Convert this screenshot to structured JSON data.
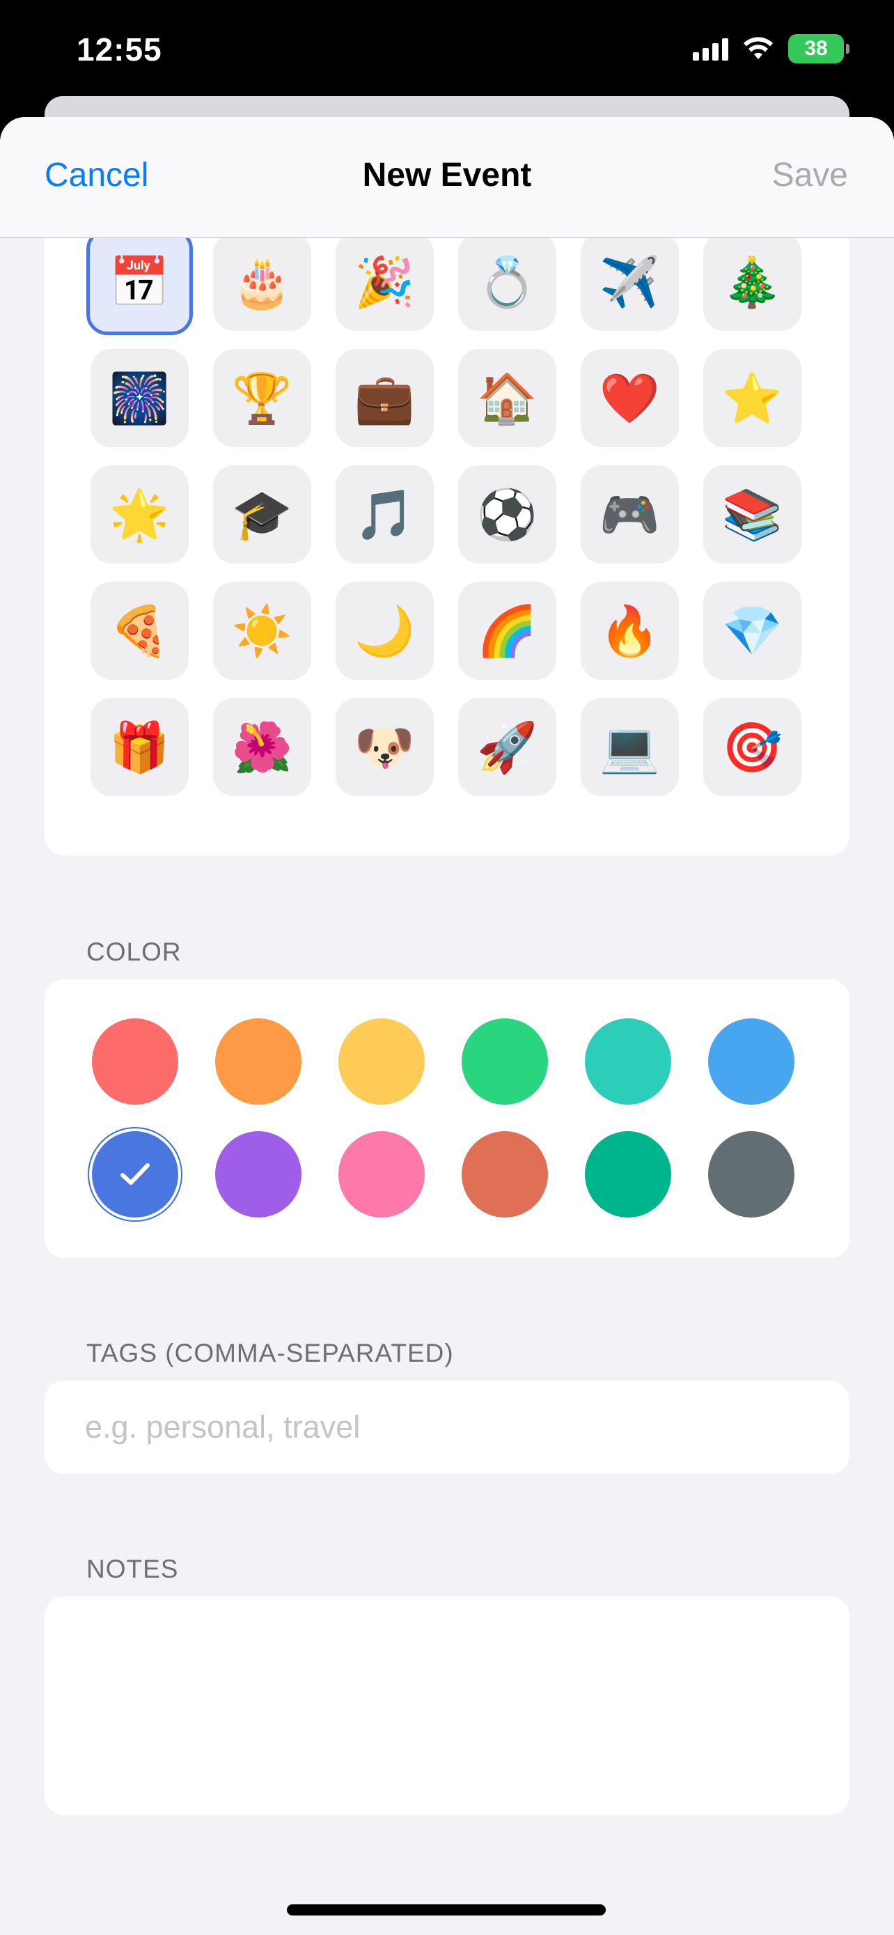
{
  "status": {
    "time": "12:55",
    "battery": "38"
  },
  "nav": {
    "cancel": "Cancel",
    "title": "New Event",
    "save": "Save"
  },
  "emojis": [
    {
      "name": "calendar-emoji",
      "char": "📅",
      "selected": true
    },
    {
      "name": "birthday-cake-emoji",
      "char": "🎂"
    },
    {
      "name": "party-popper-emoji",
      "char": "🎉"
    },
    {
      "name": "ring-emoji",
      "char": "💍"
    },
    {
      "name": "airplane-emoji",
      "char": "✈️"
    },
    {
      "name": "christmas-tree-emoji",
      "char": "🎄"
    },
    {
      "name": "fireworks-emoji",
      "char": "🎆"
    },
    {
      "name": "trophy-emoji",
      "char": "🏆"
    },
    {
      "name": "briefcase-emoji",
      "char": "💼"
    },
    {
      "name": "house-emoji",
      "char": "🏠"
    },
    {
      "name": "red-heart-emoji",
      "char": "❤️"
    },
    {
      "name": "star-emoji",
      "char": "⭐"
    },
    {
      "name": "glowing-star-emoji",
      "char": "🌟"
    },
    {
      "name": "graduation-cap-emoji",
      "char": "🎓"
    },
    {
      "name": "musical-notes-emoji",
      "char": "🎵"
    },
    {
      "name": "soccer-ball-emoji",
      "char": "⚽"
    },
    {
      "name": "video-game-emoji",
      "char": "🎮"
    },
    {
      "name": "books-emoji",
      "char": "📚"
    },
    {
      "name": "pizza-emoji",
      "char": "🍕"
    },
    {
      "name": "sun-emoji",
      "char": "☀️"
    },
    {
      "name": "crescent-moon-emoji",
      "char": "🌙"
    },
    {
      "name": "rainbow-emoji",
      "char": "🌈"
    },
    {
      "name": "fire-emoji",
      "char": "🔥"
    },
    {
      "name": "gem-emoji",
      "char": "💎"
    },
    {
      "name": "gift-emoji",
      "char": "🎁"
    },
    {
      "name": "hibiscus-emoji",
      "char": "🌺"
    },
    {
      "name": "dog-face-emoji",
      "char": "🐶"
    },
    {
      "name": "rocket-emoji",
      "char": "🚀"
    },
    {
      "name": "laptop-emoji",
      "char": "💻"
    },
    {
      "name": "target-emoji",
      "char": "🎯"
    }
  ],
  "color_section": {
    "label": "COLOR",
    "colors": [
      {
        "name": "red",
        "hex": "#fe6b6b"
      },
      {
        "name": "orange",
        "hex": "#fe9a45"
      },
      {
        "name": "yellow",
        "hex": "#fecb57"
      },
      {
        "name": "green",
        "hex": "#2ad57f"
      },
      {
        "name": "teal",
        "hex": "#2ccdb9"
      },
      {
        "name": "sky-blue",
        "hex": "#48a6f0"
      },
      {
        "name": "blue",
        "hex": "#4a77df",
        "selected": true
      },
      {
        "name": "purple",
        "hex": "#9f5ee8"
      },
      {
        "name": "pink",
        "hex": "#fd78ab"
      },
      {
        "name": "terracotta",
        "hex": "#e07055"
      },
      {
        "name": "emerald",
        "hex": "#00b48e"
      },
      {
        "name": "slate-gray",
        "hex": "#636e73"
      }
    ]
  },
  "tags_section": {
    "label": "TAGS (COMMA-SEPARATED)",
    "value": "",
    "placeholder": "e.g. personal, travel"
  },
  "notes_section": {
    "label": "NOTES",
    "value": ""
  }
}
